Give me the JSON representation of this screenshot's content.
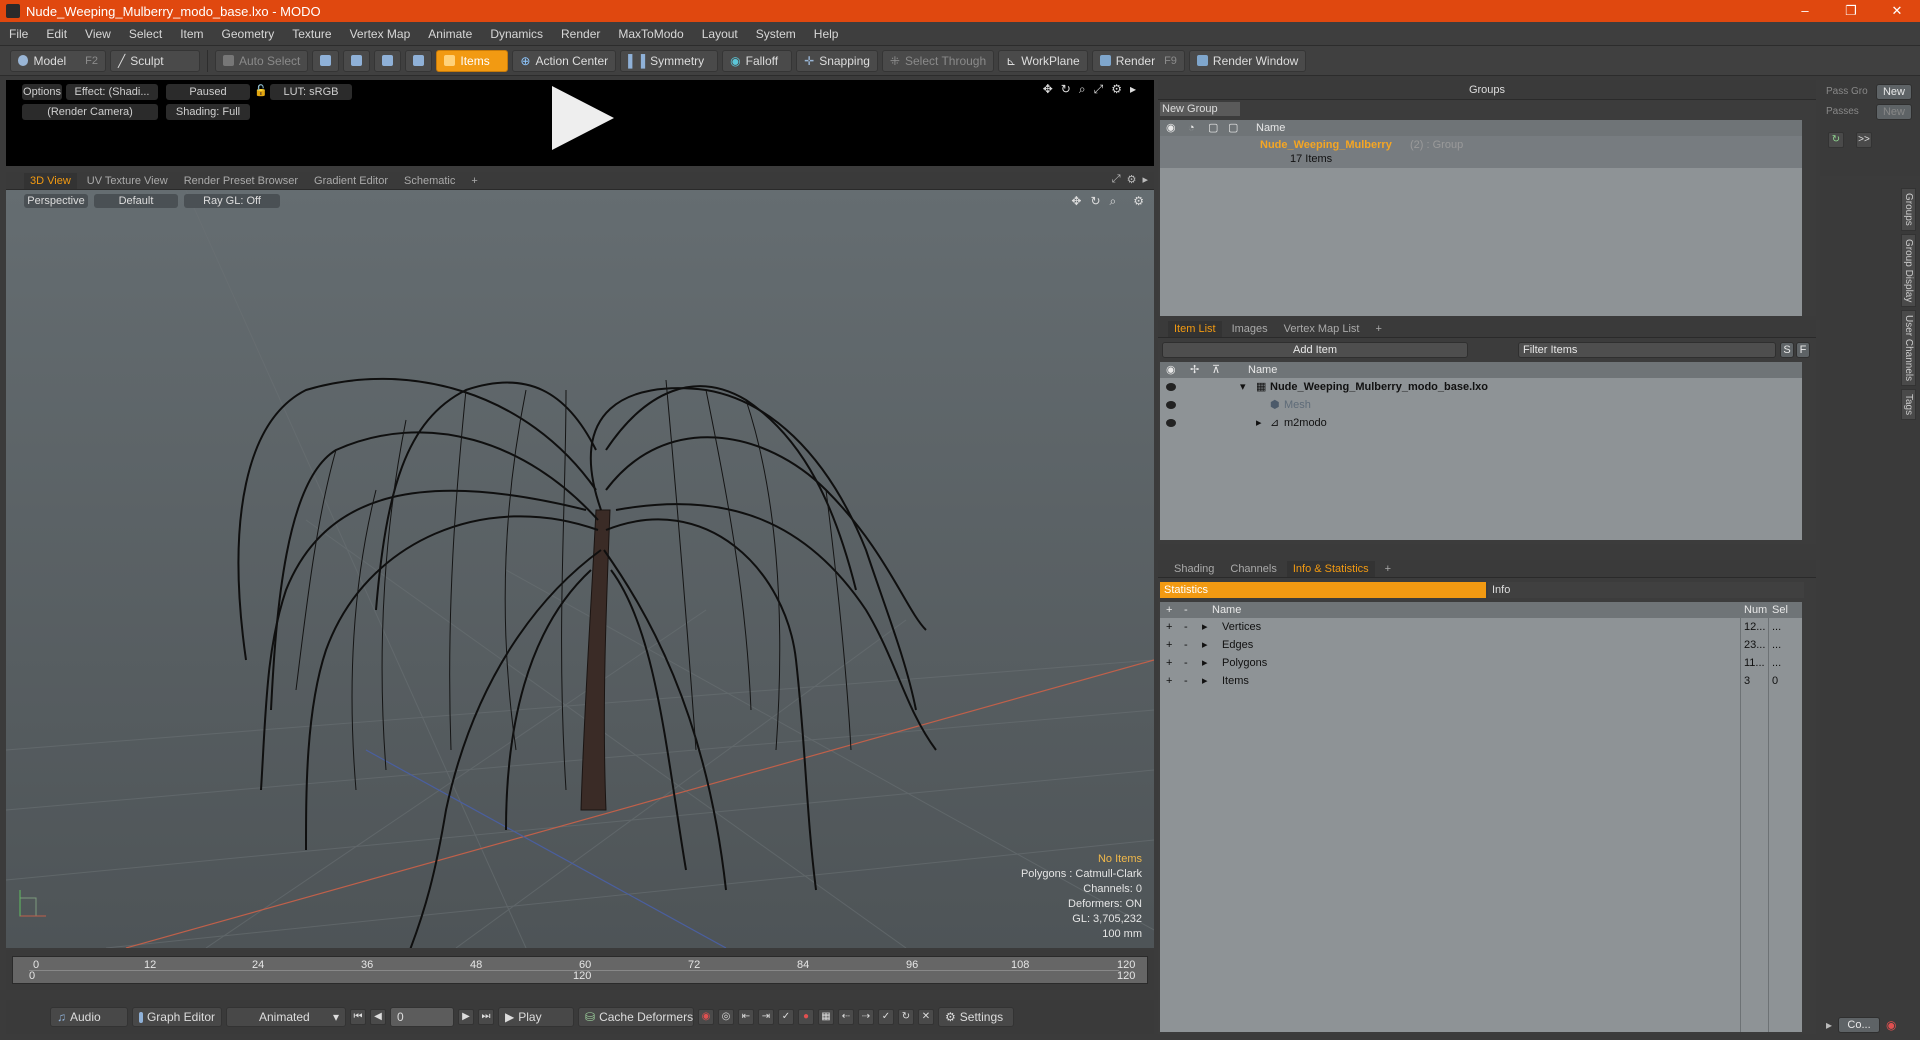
{
  "window": {
    "title": "Nude_Weeping_Mulberry_modo_base.lxo - MODO",
    "minimize": "–",
    "maximize": "❐",
    "close": "✕"
  },
  "menu": [
    "File",
    "Edit",
    "View",
    "Select",
    "Item",
    "Geometry",
    "Texture",
    "Vertex Map",
    "Animate",
    "Dynamics",
    "Render",
    "MaxToModo",
    "Layout",
    "System",
    "Help"
  ],
  "toolbar": {
    "model": "Model",
    "model_key": "F2",
    "sculpt": "Sculpt",
    "auto_select": "Auto Select",
    "items": "Items",
    "action_center": "Action Center",
    "symmetry": "Symmetry",
    "falloff": "Falloff",
    "snapping": "Snapping",
    "select_through": "Select Through",
    "workplane": "WorkPlane",
    "render": "Render",
    "render_key": "F9",
    "render_window": "Render Window"
  },
  "render_preview": {
    "options": "Options",
    "effect": "Effect: (Shadi...",
    "paused": "Paused",
    "lut": "LUT: sRGB",
    "camera": "(Render Camera)",
    "shading": "Shading: Full"
  },
  "viewport_tabs": [
    "3D View",
    "UV Texture View",
    "Render Preset Browser",
    "Gradient Editor",
    "Schematic",
    "+"
  ],
  "viewport": {
    "perspective": "Perspective",
    "default": "Default",
    "raygl": "Ray GL: Off",
    "info": {
      "no_items": "No Items",
      "polygons": "Polygons : Catmull-Clark",
      "channels": "Channels: 0",
      "deformers": "Deformers: ON",
      "gl": "GL: 3,705,232",
      "units": "100 mm"
    }
  },
  "timeline": {
    "ticks": [
      "0",
      "12",
      "24",
      "36",
      "48",
      "60",
      "72",
      "84",
      "96",
      "108",
      "120"
    ],
    "start": "0",
    "mid": "120",
    "end": "120"
  },
  "bottom": {
    "audio": "Audio",
    "graph_editor": "Graph Editor",
    "animated": "Animated",
    "frame": "0",
    "play": "Play",
    "cache_deformers": "Cache Deformers",
    "settings": "Settings"
  },
  "groups": {
    "title": "Groups",
    "new_group": "New Group",
    "name_col": "Name",
    "item_name": "Nude_Weeping_Mulberry",
    "item_meta": "(2) : Group",
    "item_count": "17 Items"
  },
  "pass": {
    "pass_group": "Pass Gro",
    "passes": "Passes",
    "new1": "New",
    "new2": "New",
    "arrows": ">>"
  },
  "item_list": {
    "tabs": [
      "Item List",
      "Images",
      "Vertex Map List",
      "+"
    ],
    "add_item": "Add Item",
    "filter": "Filter Items",
    "s": "S",
    "f": "F",
    "name_col": "Name",
    "rows": [
      {
        "label": "Nude_Weeping_Mulberry_modo_base.lxo"
      },
      {
        "label": "Mesh"
      },
      {
        "label": "m2modo"
      }
    ]
  },
  "info_stats": {
    "tabs": [
      "Shading",
      "Channels",
      "Info & Statistics",
      "+"
    ],
    "statistics": "Statistics",
    "info": "Info",
    "cols": {
      "plus": "+",
      "minus": "-",
      "name": "Name",
      "num": "Num",
      "sel": "Sel"
    },
    "rows": [
      {
        "name": "Vertices",
        "num": "12...",
        "sel": "..."
      },
      {
        "name": "Edges",
        "num": "23...",
        "sel": "..."
      },
      {
        "name": "Polygons",
        "num": "11...",
        "sel": "..."
      },
      {
        "name": "Items",
        "num": "3",
        "sel": "0"
      }
    ]
  },
  "side_tabs": [
    "Groups",
    "Group Display",
    "User Channels",
    "Tags"
  ],
  "corner": {
    "co": "Co..."
  }
}
